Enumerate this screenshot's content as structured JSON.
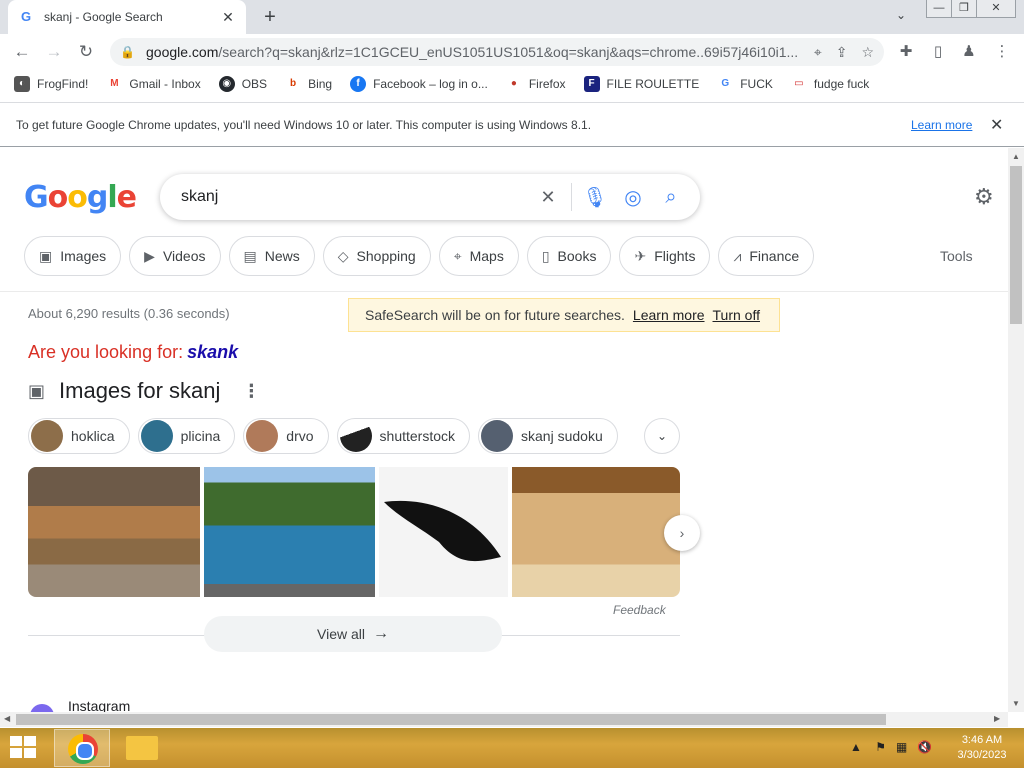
{
  "tab": {
    "favicon": "G",
    "title": "skanj - Google Search",
    "close": "✕"
  },
  "new_tab": "+",
  "window_controls": {
    "minimize": "—",
    "restore": "❐",
    "close": "✕"
  },
  "tab_search": "⌄",
  "toolbar": {
    "back": "←",
    "forward": "→",
    "reload": "↻",
    "url_domain": "google.com",
    "url_rest": "/search?q=skanj&rlz=1C1GCEU_enUS1051US1051&oq=skanj&aqs=chrome..69i57j46i10i1...",
    "icons": [
      "location-icon",
      "share-icon",
      "star-icon",
      "extensions-icon",
      "sidepanel-icon",
      "profile-icon",
      "menu-icon"
    ]
  },
  "bookmarks": [
    {
      "label": "FrogFind!",
      "icon": "frogfind-icon",
      "color": "#555555",
      "glyph": "◐"
    },
    {
      "label": "Gmail - Inbox",
      "icon": "gmail-icon",
      "color": "#ea4335",
      "glyph": "M"
    },
    {
      "label": "OBS",
      "icon": "github-icon",
      "color": "#24292e",
      "glyph": "◉"
    },
    {
      "label": "Bing",
      "icon": "bing-icon",
      "color": "#d83b01",
      "glyph": "b"
    },
    {
      "label": "Facebook – log in o...",
      "icon": "facebook-icon",
      "color": "#1877f2",
      "glyph": "f"
    },
    {
      "label": "Firefox",
      "icon": "firefox-icon",
      "color": "#c0392b",
      "glyph": "●"
    },
    {
      "label": "FILE ROULETTE",
      "icon": "fileroulette-icon",
      "color": "#1a237e",
      "glyph": "F"
    },
    {
      "label": "FUCK",
      "icon": "google-icon",
      "color": "#4285f4",
      "glyph": "G"
    },
    {
      "label": "fudge fuck",
      "icon": "mail-icon",
      "color": "#d32f2f",
      "glyph": "▭"
    }
  ],
  "infobar": {
    "message": "To get future Google Chrome updates, you'll need Windows 10 or later. This computer is using Windows 8.1.",
    "learn_more": "Learn more",
    "close": "✕"
  },
  "search": {
    "query": "skanj",
    "clear": "✕"
  },
  "nav_chips": [
    {
      "label": "Images",
      "icon": "image-icon",
      "glyph": "▣"
    },
    {
      "label": "Videos",
      "icon": "video-icon",
      "glyph": "▶"
    },
    {
      "label": "News",
      "icon": "news-icon",
      "glyph": "▤"
    },
    {
      "label": "Shopping",
      "icon": "tag-icon",
      "glyph": "◇"
    },
    {
      "label": "Maps",
      "icon": "pin-icon",
      "glyph": "⌖"
    },
    {
      "label": "Books",
      "icon": "book-icon",
      "glyph": "▯"
    },
    {
      "label": "Flights",
      "icon": "plane-icon",
      "glyph": "✈"
    },
    {
      "label": "Finance",
      "icon": "chart-icon",
      "glyph": "⩘"
    }
  ],
  "tools": "Tools",
  "result_stats": "About 6,290 results (0.36 seconds)",
  "safesearch": {
    "message": "SafeSearch will be on for future searches.",
    "learn_more": "Learn more",
    "turn_off": "Turn off"
  },
  "did_you_mean": {
    "prefix": "Are you looking for:",
    "term": "skank"
  },
  "images_section": {
    "heading": "Images for skanj",
    "filters": [
      {
        "label": "hoklica",
        "color": "#8d6e4a"
      },
      {
        "label": "plicina",
        "color": "#2e6f8e"
      },
      {
        "label": "drvo",
        "color": "#b07a5a"
      },
      {
        "label": "shutterstock",
        "color": "#222222"
      },
      {
        "label": "skanj sudoku",
        "color": "#556070"
      }
    ],
    "thumbnails": [
      {
        "name": "wooden-stool-image",
        "color": "#8a6a45"
      },
      {
        "name": "bay-with-boats-image",
        "color": "#1f5f8b"
      },
      {
        "name": "island-map-image",
        "color": "#eeeeee"
      },
      {
        "name": "wooden-stools-image",
        "color": "#c9a06a"
      }
    ],
    "feedback": "Feedback",
    "view_all": "View all"
  },
  "next_result": "Instagram",
  "taskbar": {
    "time": "3:46 AM",
    "date": "3/30/2023"
  }
}
